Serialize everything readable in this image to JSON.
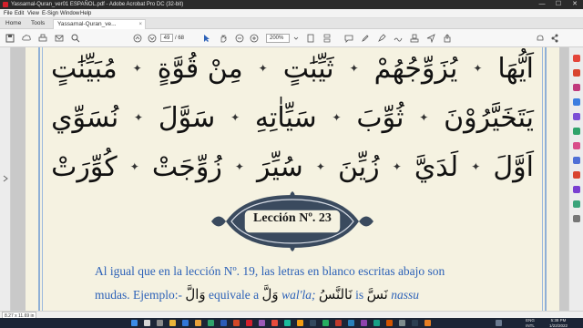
{
  "window": {
    "title": "Yassarnal-Quran_ver01 ESPAÑOL.pdf - Adobe Acrobat Pro DC (32-bit)",
    "minimize": "—",
    "maximize": "☐",
    "close": "✕"
  },
  "menu": [
    "File",
    "Edit",
    "View",
    "E-Sign",
    "Window",
    "Help"
  ],
  "tabs": {
    "home": "Home",
    "tools": "Tools",
    "document": "Yassarnal-Quran_ve...",
    "close": "×"
  },
  "toolbar": {
    "current_page": "49",
    "total_pages": "/ 68",
    "zoom": "200%"
  },
  "document": {
    "arabic_rows": [
      [
        "مُبَيِّنَٰتٍ",
        "مِنْ قُوَّةٍ",
        "ثَيِّبَٰتٍ",
        "يُزَوِّجُهُمْ",
        "اَيُّهَا"
      ],
      [
        "نُسَوِّي",
        "سَوَّلَ",
        "سَيِّاٰتِهِ",
        "ثُوِّبَ",
        "يَتَخَيَّرُوْنَ"
      ],
      [
        "كُوِّرَتْ",
        "زُوِّجَتْ",
        "سُيِّرَ",
        "زُيِّنَ",
        "لَدَيَّ",
        "اَوَّلَ"
      ]
    ],
    "separator": "✦",
    "lesson_title": "Lección Nº. 23",
    "paragraph_line1": "Al igual que en la lección Nº. 19, las letras en blanco escritas abajo son",
    "paragraph_line2_a": "mudas. Ejemplo:-",
    "paragraph_line2_ar1": "وَالَّ",
    "paragraph_line2_b": "equivale a",
    "paragraph_line2_ar2": "وَلَّ",
    "paragraph_line2_c": "wal'la;",
    "paragraph_line2_ar3": "نَالنَّسُ",
    "paragraph_line2_d": "is",
    "paragraph_line2_ar4": "نَسَّ",
    "paragraph_line2_e": "nassu"
  },
  "statusbar": {
    "dimensions": "8.27 x 11.69 in"
  },
  "tray": {
    "lang": "ENG",
    "lang2": "INTL",
    "time": "5:38 PM",
    "date": "1/22/2022"
  },
  "colors": {
    "page_bg": "#f5f2e1",
    "text_blue": "#2d62b8",
    "frame_blue": "#8fb0d6",
    "cartouche_fill": "#3a4a5e"
  }
}
